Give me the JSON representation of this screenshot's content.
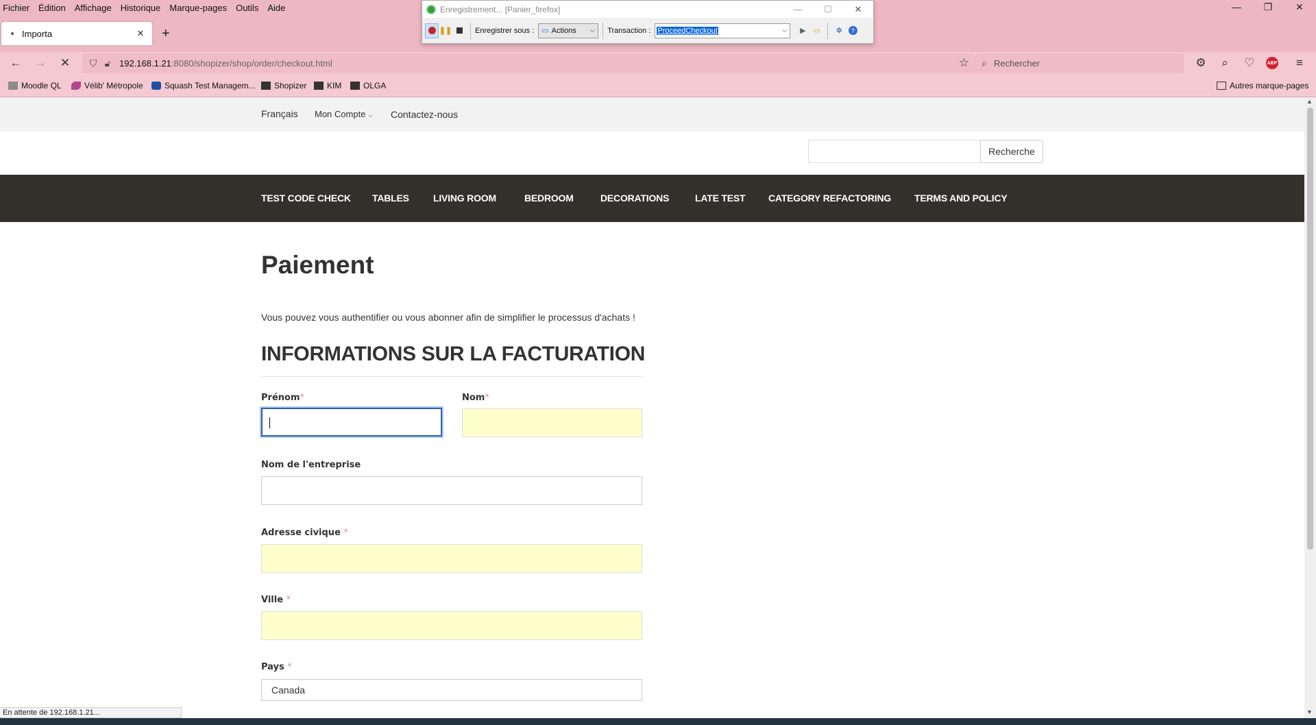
{
  "menu": [
    "Fichier",
    "Édition",
    "Affichage",
    "Historique",
    "Marque-pages",
    "Outils",
    "Aide"
  ],
  "tab": {
    "title": "Importa",
    "close": "✕",
    "new": "+"
  },
  "window_controls": {
    "minimize": "—",
    "restore": "❐",
    "close": "✕"
  },
  "nav": {
    "back": "←",
    "forward": "→",
    "stop": "✕",
    "url_host": "192.168.1.21",
    "url_path": ":8080/shopizer/shop/order/checkout.html",
    "search_placeholder": "Rechercher",
    "abp": "ABP"
  },
  "bookmarks": [
    {
      "label": "Moodle QL",
      "color": "#7a7a7a"
    },
    {
      "label": "Vélib' Métropole",
      "color": "#b2468f"
    },
    {
      "label": "Squash Test Managem...",
      "color": "#1e4fa3"
    },
    {
      "label": "Shopizer",
      "color": "#333333"
    },
    {
      "label": "KIM",
      "color": "#333333"
    },
    {
      "label": "OLGA",
      "color": "#333333"
    }
  ],
  "bookmarks_other": "Autres marque-pages",
  "recorder": {
    "title": "Enregistrement... [Panier_firefox]",
    "save_under_label": "Enregistrer sous :",
    "save_under_value": "Actions",
    "transaction_label": "Transaction :",
    "transaction_value": "ProceedCheckout"
  },
  "site": {
    "top_links": [
      "Français",
      "Mon Compte",
      "Contactez-nous"
    ],
    "search_button": "Recherche",
    "categories": [
      "TEST CODE CHECK",
      "TABLES",
      "LIVING ROOM",
      "BEDROOM",
      "DECORATIONS",
      "LATE TEST",
      "CATEGORY REFACTORING",
      "TERMS AND POLICY"
    ]
  },
  "checkout": {
    "title": "Paiement",
    "intro": "Vous pouvez vous authentifier ou vous abonner afin de simplifier le processus d'achats !",
    "section_title": "INFORMATIONS SUR LA FACTURATION",
    "labels": {
      "first_name": "Prénom",
      "last_name": "Nom",
      "company": "Nom de l'entreprise",
      "address": "Adresse civique",
      "city": "Ville",
      "country": "Pays"
    },
    "required_mark": "*",
    "country_value": "Canada"
  },
  "status_text": "En attente de 192.168.1.21..."
}
